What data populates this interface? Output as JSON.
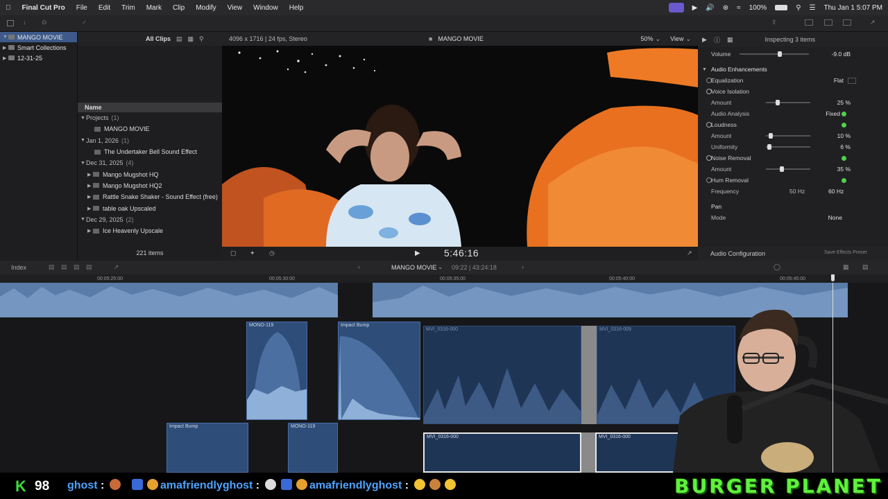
{
  "menubar": {
    "app": "Final Cut Pro",
    "items": [
      "File",
      "Edit",
      "Trim",
      "Mark",
      "Clip",
      "Modify",
      "View",
      "Window",
      "Help"
    ],
    "battery": "100%",
    "clock": "Thu Jan 1  5:07 PM"
  },
  "libraries": {
    "items": [
      {
        "label": "MANGO MOVIE",
        "selected": true
      },
      {
        "label": "Smart Collections",
        "selected": false
      },
      {
        "label": "12-31-25",
        "selected": false
      }
    ]
  },
  "browser": {
    "filter": "All Clips",
    "column_header": "Name",
    "footer": "221 items",
    "rows": [
      {
        "type": "group",
        "label": "Projects",
        "count": "(1)"
      },
      {
        "type": "item",
        "label": "MANGO MOVIE"
      },
      {
        "type": "group",
        "label": "Jan 1, 2026",
        "count": "(1)"
      },
      {
        "type": "item",
        "label": "The Undertaker Bell  Sound Effect"
      },
      {
        "type": "group",
        "label": "Dec 31, 2025",
        "count": "(4)"
      },
      {
        "type": "item",
        "label": "Mango Mugshot HQ"
      },
      {
        "type": "item",
        "label": "Mango Mugshot HQ2"
      },
      {
        "type": "item",
        "label": "Rattle Snake Shaker - Sound Effect (free)"
      },
      {
        "type": "item",
        "label": "table oak Upscaled"
      },
      {
        "type": "group",
        "label": "Dec 29, 2025",
        "count": "(2)"
      },
      {
        "type": "item",
        "label": "Ice Heavenly Upscale"
      }
    ]
  },
  "viewer": {
    "format": "4096 x 1716 | 24 fps, Stereo",
    "title": "MANGO MOVIE",
    "zoom": "50%",
    "view": "View",
    "timecode": "5:46:16"
  },
  "inspector": {
    "header": "Inspecting 3 items",
    "volume_label": "Volume",
    "volume_value": "-9.0  dB",
    "section": "Audio Enhancements",
    "equalization_label": "Equalization",
    "equalization_value": "Flat",
    "voice_isolation": "Voice Isolation",
    "amount_label": "Amount",
    "voice_amount": "25 %",
    "audio_analysis": "Audio Analysis",
    "audio_analysis_value": "Fixed",
    "loudness": "Loudness",
    "loudness_amount": "10 %",
    "uniformity_label": "Uniformity",
    "uniformity_value": "6 %",
    "noise_removal": "Noise Removal",
    "noise_amount": "35 %",
    "hum_removal": "Hum Removal",
    "frequency_label": "Frequency",
    "freq_50": "50 Hz",
    "freq_60": "60 Hz",
    "pan": "Pan",
    "mode_label": "Mode",
    "mode_value": "None",
    "footer_left": "Audio Configuration",
    "footer_right": "Save Effects Preset"
  },
  "timeline": {
    "index": "Index",
    "project": "MANGO MOVIE",
    "duration": "09:22 | 43:24:18",
    "ruler": [
      "00:05:25:00",
      "00:05:30:00",
      "00:05:35:00",
      "00:05:40:00",
      "00:05:45:00"
    ],
    "clips": {
      "mono1": "MONO-119",
      "impact1": "Impact Bump",
      "mvi_a": "MVI_0316-000",
      "mvi_b": "MVI_0316-009",
      "impact2": "Impact Bump",
      "mono2": "MONO-119",
      "mvi_c": "MVI_0316-000",
      "mvi_d": "MVI_0316-000"
    }
  },
  "chat": {
    "kick_count": "98",
    "user1": "ghost",
    "user2": "amafriendlyghost",
    "user3": "amafriendlyghost",
    "brand": "BURGER PLANET"
  }
}
